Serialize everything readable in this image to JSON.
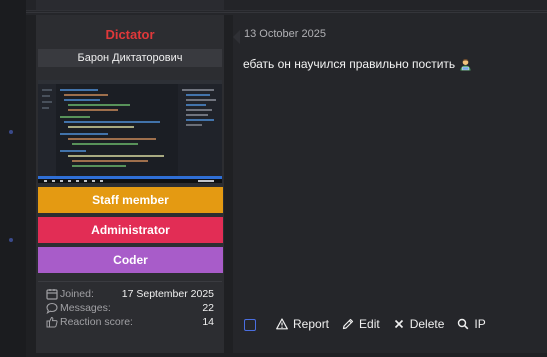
{
  "user": {
    "name": "Dictator",
    "title": "Барон Диктаторович",
    "banners": [
      "Staff member",
      "Administrator",
      "Coder"
    ],
    "stats": [
      {
        "label": "Joined:",
        "value": "17 September 2025",
        "icon": "calendar-icon"
      },
      {
        "label": "Messages:",
        "value": "22",
        "icon": "speech-bubble-icon"
      },
      {
        "label": "Reaction score:",
        "value": "14",
        "icon": "thumbs-up-icon"
      }
    ]
  },
  "message": {
    "date": "13 October 2025",
    "text": "ебать он научился правильно постить",
    "emoji": "technologist-emoji"
  },
  "actions": [
    {
      "label": "Report",
      "icon": "warning-triangle-icon"
    },
    {
      "label": "Edit",
      "icon": "pencil-icon"
    },
    {
      "label": "Delete",
      "icon": "cross-icon"
    },
    {
      "label": "IP",
      "icon": "magnifier-icon"
    }
  ],
  "colors": {
    "username": "#e0383a",
    "staff_banner": "#e49a12",
    "admin_banner": "#e22d55",
    "coder_banner": "#a85cc9",
    "checkbox_border": "#4a6ee0"
  }
}
